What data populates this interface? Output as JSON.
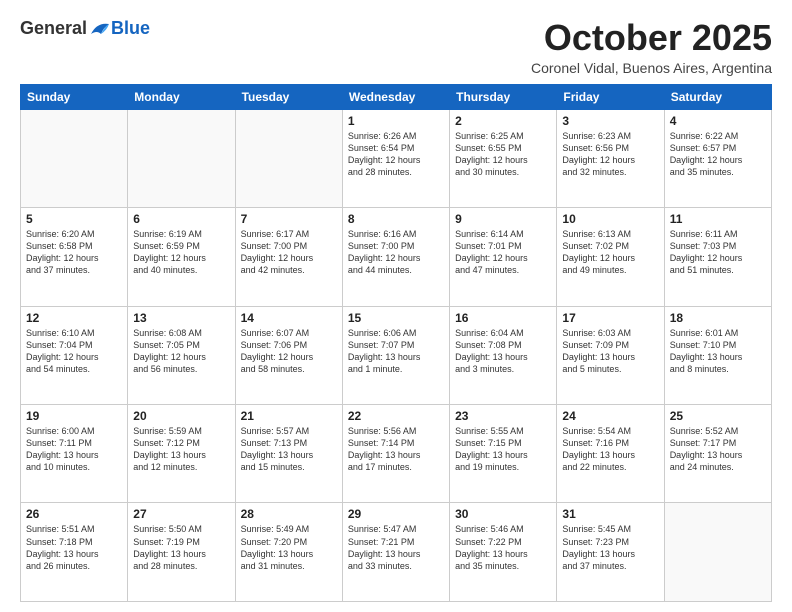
{
  "header": {
    "logo_general": "General",
    "logo_blue": "Blue",
    "month_title": "October 2025",
    "subtitle": "Coronel Vidal, Buenos Aires, Argentina"
  },
  "days_of_week": [
    "Sunday",
    "Monday",
    "Tuesday",
    "Wednesday",
    "Thursday",
    "Friday",
    "Saturday"
  ],
  "weeks": [
    [
      {
        "day": "",
        "info": ""
      },
      {
        "day": "",
        "info": ""
      },
      {
        "day": "",
        "info": ""
      },
      {
        "day": "1",
        "info": "Sunrise: 6:26 AM\nSunset: 6:54 PM\nDaylight: 12 hours\nand 28 minutes."
      },
      {
        "day": "2",
        "info": "Sunrise: 6:25 AM\nSunset: 6:55 PM\nDaylight: 12 hours\nand 30 minutes."
      },
      {
        "day": "3",
        "info": "Sunrise: 6:23 AM\nSunset: 6:56 PM\nDaylight: 12 hours\nand 32 minutes."
      },
      {
        "day": "4",
        "info": "Sunrise: 6:22 AM\nSunset: 6:57 PM\nDaylight: 12 hours\nand 35 minutes."
      }
    ],
    [
      {
        "day": "5",
        "info": "Sunrise: 6:20 AM\nSunset: 6:58 PM\nDaylight: 12 hours\nand 37 minutes."
      },
      {
        "day": "6",
        "info": "Sunrise: 6:19 AM\nSunset: 6:59 PM\nDaylight: 12 hours\nand 40 minutes."
      },
      {
        "day": "7",
        "info": "Sunrise: 6:17 AM\nSunset: 7:00 PM\nDaylight: 12 hours\nand 42 minutes."
      },
      {
        "day": "8",
        "info": "Sunrise: 6:16 AM\nSunset: 7:00 PM\nDaylight: 12 hours\nand 44 minutes."
      },
      {
        "day": "9",
        "info": "Sunrise: 6:14 AM\nSunset: 7:01 PM\nDaylight: 12 hours\nand 47 minutes."
      },
      {
        "day": "10",
        "info": "Sunrise: 6:13 AM\nSunset: 7:02 PM\nDaylight: 12 hours\nand 49 minutes."
      },
      {
        "day": "11",
        "info": "Sunrise: 6:11 AM\nSunset: 7:03 PM\nDaylight: 12 hours\nand 51 minutes."
      }
    ],
    [
      {
        "day": "12",
        "info": "Sunrise: 6:10 AM\nSunset: 7:04 PM\nDaylight: 12 hours\nand 54 minutes."
      },
      {
        "day": "13",
        "info": "Sunrise: 6:08 AM\nSunset: 7:05 PM\nDaylight: 12 hours\nand 56 minutes."
      },
      {
        "day": "14",
        "info": "Sunrise: 6:07 AM\nSunset: 7:06 PM\nDaylight: 12 hours\nand 58 minutes."
      },
      {
        "day": "15",
        "info": "Sunrise: 6:06 AM\nSunset: 7:07 PM\nDaylight: 13 hours\nand 1 minute."
      },
      {
        "day": "16",
        "info": "Sunrise: 6:04 AM\nSunset: 7:08 PM\nDaylight: 13 hours\nand 3 minutes."
      },
      {
        "day": "17",
        "info": "Sunrise: 6:03 AM\nSunset: 7:09 PM\nDaylight: 13 hours\nand 5 minutes."
      },
      {
        "day": "18",
        "info": "Sunrise: 6:01 AM\nSunset: 7:10 PM\nDaylight: 13 hours\nand 8 minutes."
      }
    ],
    [
      {
        "day": "19",
        "info": "Sunrise: 6:00 AM\nSunset: 7:11 PM\nDaylight: 13 hours\nand 10 minutes."
      },
      {
        "day": "20",
        "info": "Sunrise: 5:59 AM\nSunset: 7:12 PM\nDaylight: 13 hours\nand 12 minutes."
      },
      {
        "day": "21",
        "info": "Sunrise: 5:57 AM\nSunset: 7:13 PM\nDaylight: 13 hours\nand 15 minutes."
      },
      {
        "day": "22",
        "info": "Sunrise: 5:56 AM\nSunset: 7:14 PM\nDaylight: 13 hours\nand 17 minutes."
      },
      {
        "day": "23",
        "info": "Sunrise: 5:55 AM\nSunset: 7:15 PM\nDaylight: 13 hours\nand 19 minutes."
      },
      {
        "day": "24",
        "info": "Sunrise: 5:54 AM\nSunset: 7:16 PM\nDaylight: 13 hours\nand 22 minutes."
      },
      {
        "day": "25",
        "info": "Sunrise: 5:52 AM\nSunset: 7:17 PM\nDaylight: 13 hours\nand 24 minutes."
      }
    ],
    [
      {
        "day": "26",
        "info": "Sunrise: 5:51 AM\nSunset: 7:18 PM\nDaylight: 13 hours\nand 26 minutes."
      },
      {
        "day": "27",
        "info": "Sunrise: 5:50 AM\nSunset: 7:19 PM\nDaylight: 13 hours\nand 28 minutes."
      },
      {
        "day": "28",
        "info": "Sunrise: 5:49 AM\nSunset: 7:20 PM\nDaylight: 13 hours\nand 31 minutes."
      },
      {
        "day": "29",
        "info": "Sunrise: 5:47 AM\nSunset: 7:21 PM\nDaylight: 13 hours\nand 33 minutes."
      },
      {
        "day": "30",
        "info": "Sunrise: 5:46 AM\nSunset: 7:22 PM\nDaylight: 13 hours\nand 35 minutes."
      },
      {
        "day": "31",
        "info": "Sunrise: 5:45 AM\nSunset: 7:23 PM\nDaylight: 13 hours\nand 37 minutes."
      },
      {
        "day": "",
        "info": ""
      }
    ]
  ]
}
